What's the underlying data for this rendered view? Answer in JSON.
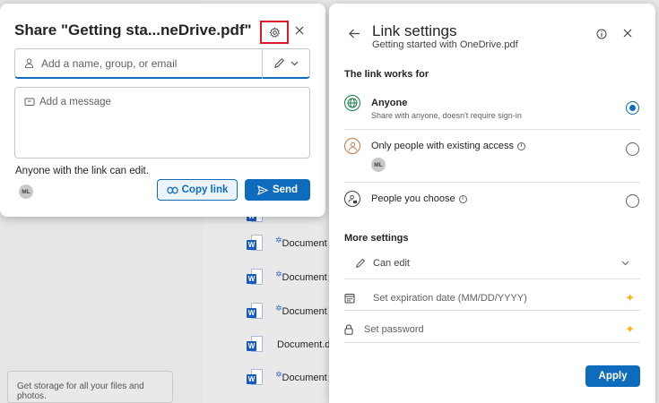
{
  "share_dialog": {
    "title": "Share \"Getting sta...neDrive.pdf\"",
    "recipient_placeholder": "Add a name, group, or email",
    "message_placeholder": "Add a message",
    "link_note": "Anyone with the link can edit.",
    "avatar_initials": "ML",
    "copy_link_label": "Copy link",
    "send_label": "Send"
  },
  "link_settings": {
    "title": "Link settings",
    "subtitle": "Getting started with OneDrive.pdf",
    "section_works_for": "The link works for",
    "options": [
      {
        "label": "Anyone",
        "description": "Share with anyone, doesn't require sign-in",
        "selected": true
      },
      {
        "label": "Only people with existing access",
        "avatar_initials": "ML",
        "selected": false
      },
      {
        "label": "People you choose",
        "selected": false
      }
    ],
    "section_more": "More settings",
    "permission": "Can edit",
    "expiration_placeholder": "Set expiration date (MM/DD/YYYY)",
    "password_placeholder": "Set password",
    "apply_label": "Apply"
  },
  "background": {
    "files": [
      "Document",
      "Document",
      "Document",
      "Document.d",
      "Document"
    ],
    "storage_text": "Get storage for all your files and photos."
  },
  "colors": {
    "accent": "#0f6cbd",
    "highlight_border": "#e0152c",
    "premium_sparkle": "#f5b719",
    "word_blue": "#185abd"
  }
}
